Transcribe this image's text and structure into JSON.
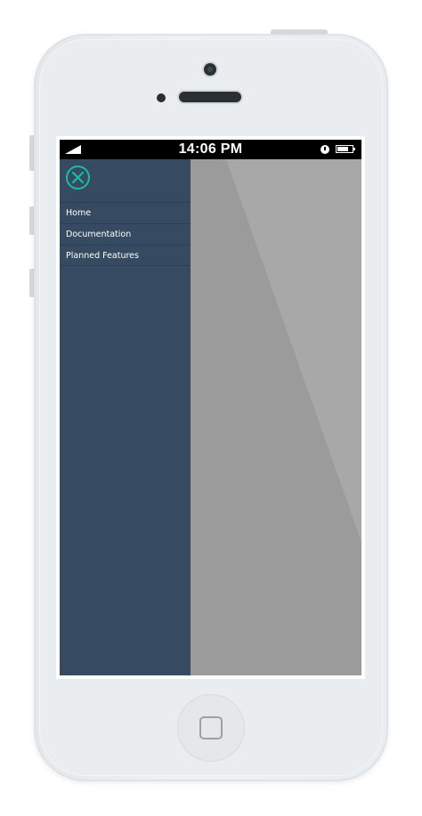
{
  "status_bar": {
    "time": "14:06 PM",
    "signal_icon": "signal-icon",
    "alarm_icon": "alarm-icon",
    "battery_icon": "battery-icon"
  },
  "drawer": {
    "close_icon": "close-icon",
    "accent_color": "#1abc9c",
    "background_color": "#364b61",
    "items": [
      {
        "label": "Home"
      },
      {
        "label": "Documentation"
      },
      {
        "label": "Planned Features"
      }
    ]
  },
  "content": {
    "background_color": "#9b9b9b"
  },
  "device": {
    "home_button_icon": "home-square-icon",
    "body_color": "#e9edf0"
  }
}
